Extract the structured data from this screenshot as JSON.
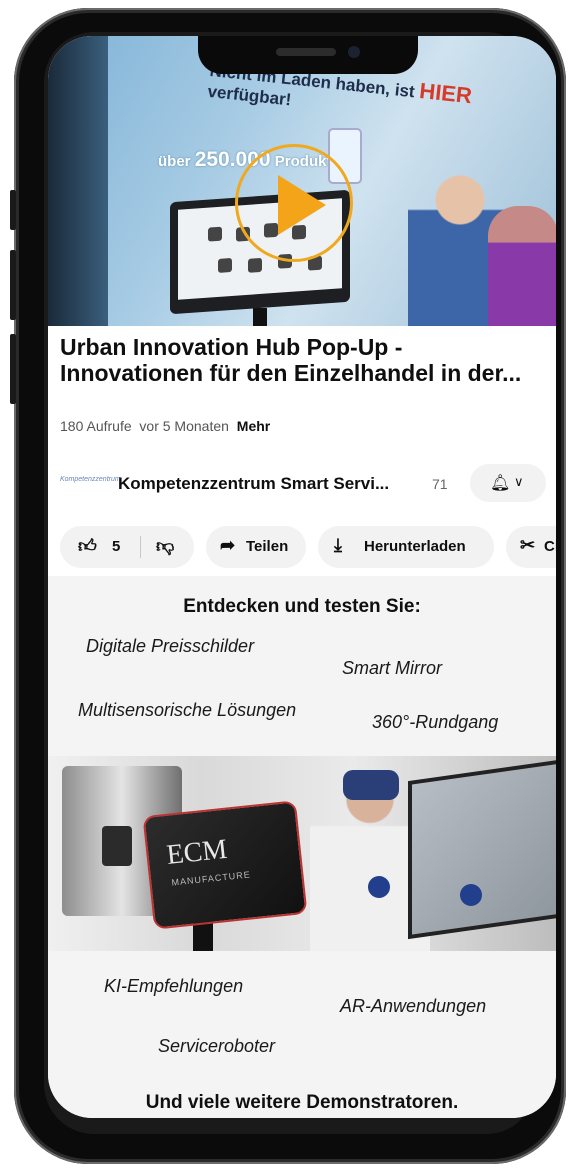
{
  "video": {
    "banner_text_part1": "Nicht im Laden haben, ist",
    "banner_text_hier": "HIER",
    "banner_text_part2": "verfügbar!",
    "products_prefix": "über",
    "products_count": "250.000",
    "products_suffix": "Produkte"
  },
  "title": "Urban Innovation Hub Pop-Up - Innovationen für den Einzelhandel in der...",
  "meta": {
    "views": "180 Aufrufe",
    "age": "vor 5 Monaten",
    "more": "Mehr"
  },
  "channel": {
    "logo_text": "Kompetenzzentrum",
    "name": "Kompetenzzentrum Smart Servi...",
    "subscribers": "71"
  },
  "actions": {
    "likes": "5",
    "share": "Teilen",
    "download": "Herunterladen",
    "clip": "Cl"
  },
  "promo": {
    "heading": "Entdecken und testen Sie:",
    "features_top": [
      "Digitale Preisschilder",
      "Smart Mirror",
      "Multisensorische Lösungen",
      "360°-Rundgang"
    ],
    "features_bottom": [
      "KI-Empfehlungen",
      "AR-Anwendungen",
      "Serviceroboter"
    ],
    "closing": "Und viele weitere Demonstratoren.",
    "sign_brand": "ECM",
    "sign_sub": "MANUFACTURE"
  },
  "colors": {
    "play_accent": "#f3a419",
    "pill_bg": "#f2f2f2",
    "section_bg": "#f4f4f4"
  }
}
